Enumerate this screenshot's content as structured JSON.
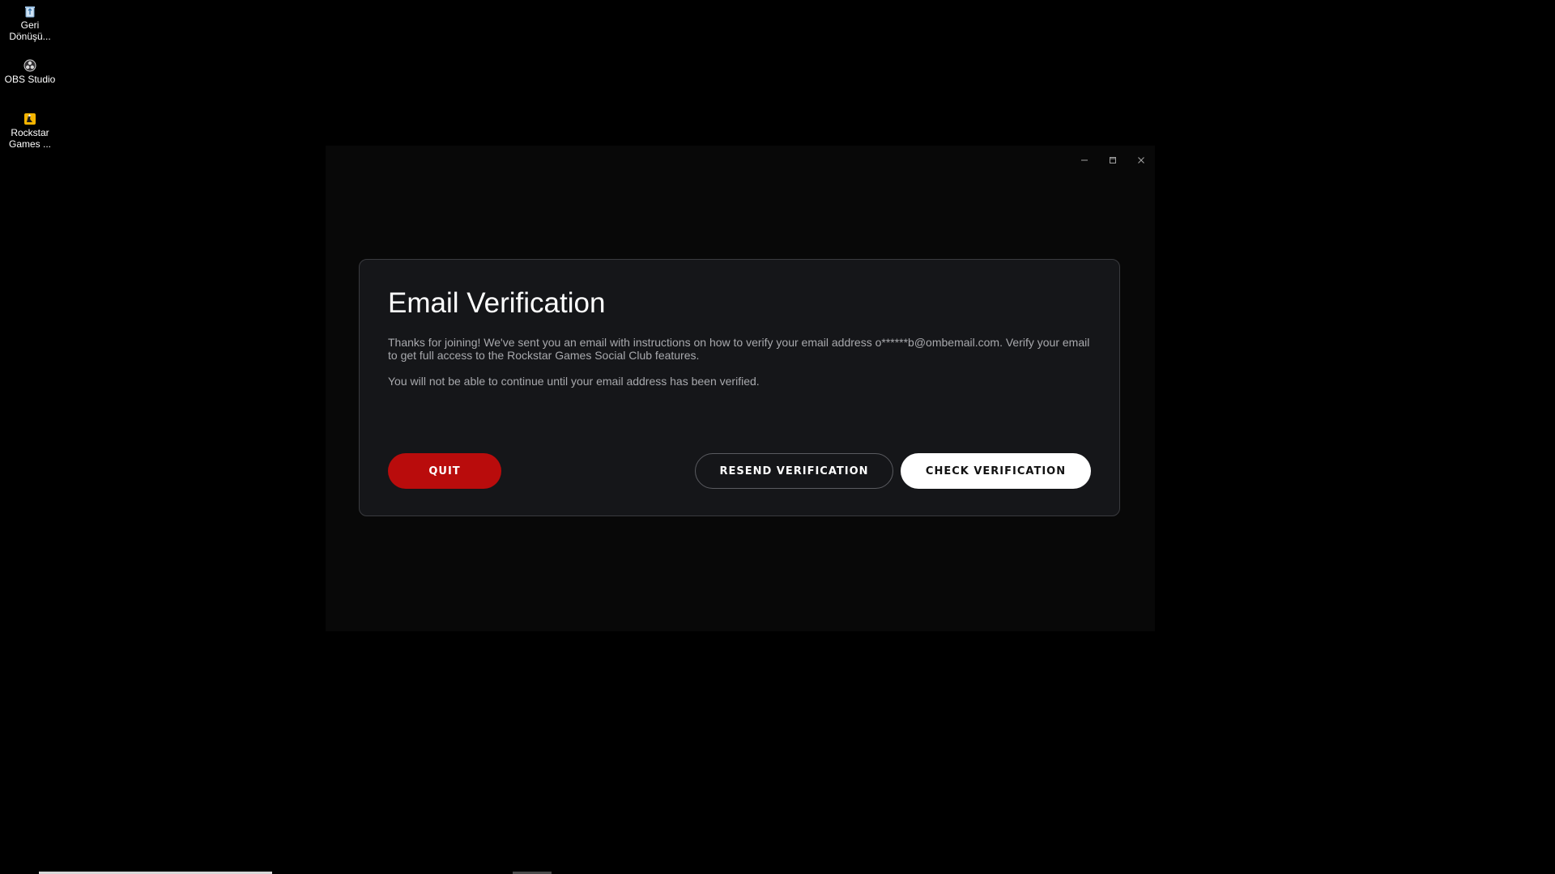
{
  "desktop": {
    "icons": [
      {
        "label": "Geri Dönüşü...",
        "icon": "recycle-bin-icon"
      },
      {
        "label": "OBS Studio",
        "icon": "obs-studio-icon"
      },
      {
        "label": "Rockstar Games ...",
        "icon": "rockstar-games-launcher-icon"
      }
    ]
  },
  "window": {
    "controls": {
      "minimize": "minimize-icon",
      "maximize": "maximize-icon",
      "close": "close-icon"
    },
    "dialog": {
      "title": "Email Verification",
      "paragraph1": "Thanks for joining! We've sent you an email with instructions on how to verify your email address o******b@ombemail.com. Verify your email to get full access to the Rockstar Games Social Club features.",
      "paragraph2": "You will not be able to continue until your email address has been verified.",
      "buttons": {
        "quit": "QUIT",
        "resend": "RESEND VERIFICATION",
        "check": "CHECK VERIFICATION"
      }
    }
  },
  "colors": {
    "background": "#000000",
    "window_bg": "#080808",
    "card_bg": "#151619",
    "quit_red": "#b90c0c",
    "check_white": "#ffffff",
    "body_text": "#a8a9ad"
  }
}
